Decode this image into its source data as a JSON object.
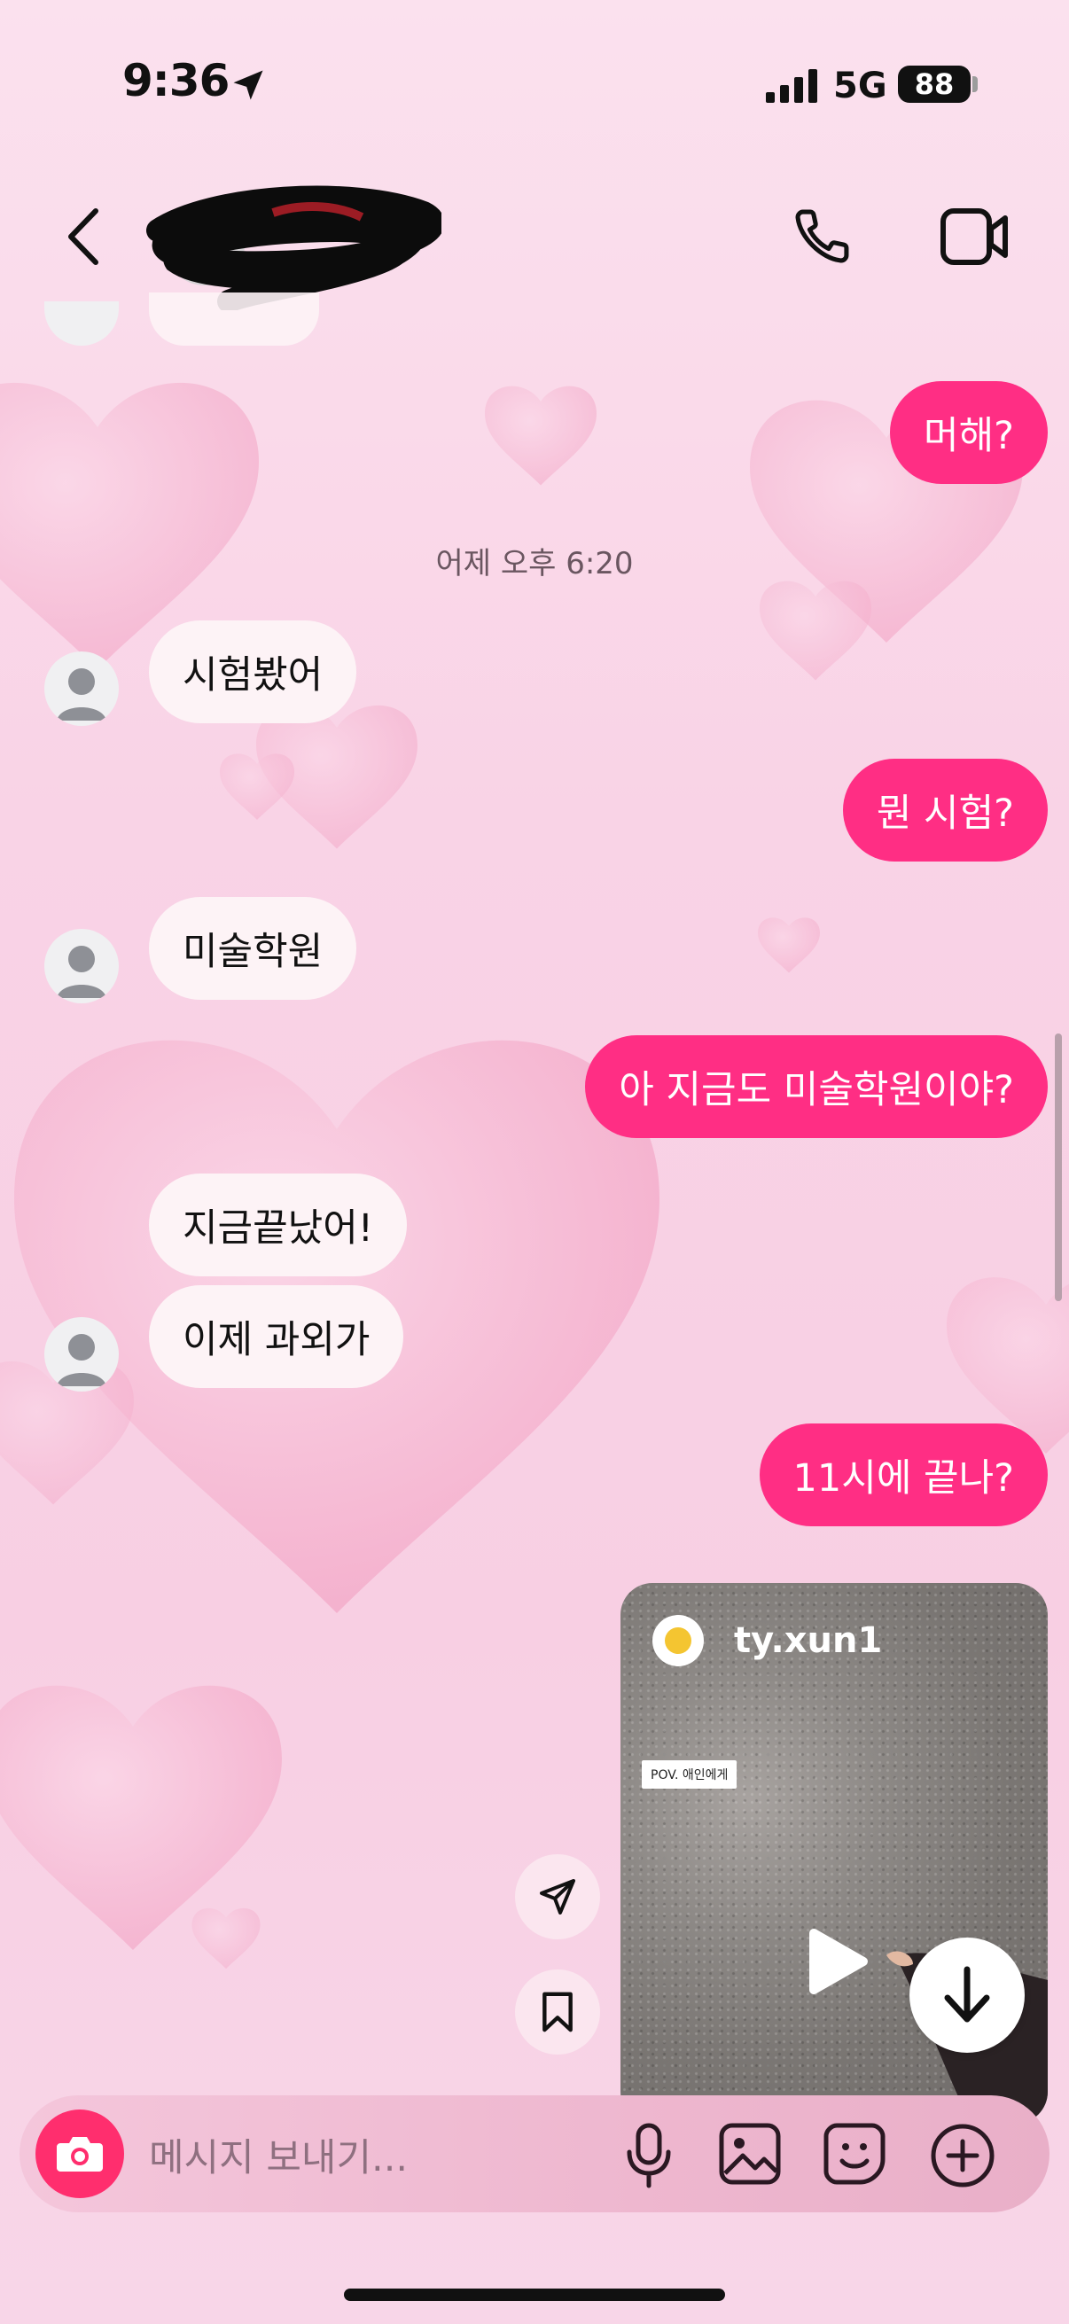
{
  "status_bar": {
    "time": "9:36",
    "network": "5G",
    "battery": "88"
  },
  "header": {
    "contact_name": ""
  },
  "thread": {
    "timestamp": "어제 오후 6:20",
    "messages": [
      {
        "from": "me",
        "text": "머해?"
      },
      {
        "from": "them",
        "text": "시험봤어"
      },
      {
        "from": "me",
        "text": "뭔 시험?"
      },
      {
        "from": "them",
        "text": "미술학원"
      },
      {
        "from": "me",
        "text": "아 지금도 미술학원이야?"
      },
      {
        "from": "them",
        "text": "지금끝났어!"
      },
      {
        "from": "them",
        "text": "이제 과외가"
      },
      {
        "from": "me",
        "text": "11시에 끝나?"
      }
    ]
  },
  "shared_reel": {
    "username": "ty.xun1",
    "caption_tag": "POV. 애인에게"
  },
  "composer": {
    "placeholder": "메시지 보내기..."
  },
  "colors": {
    "outgoing_bubble": "#ff2e84",
    "incoming_bubble": "#fdf3f6",
    "camera_button": "#ff2e6e"
  }
}
